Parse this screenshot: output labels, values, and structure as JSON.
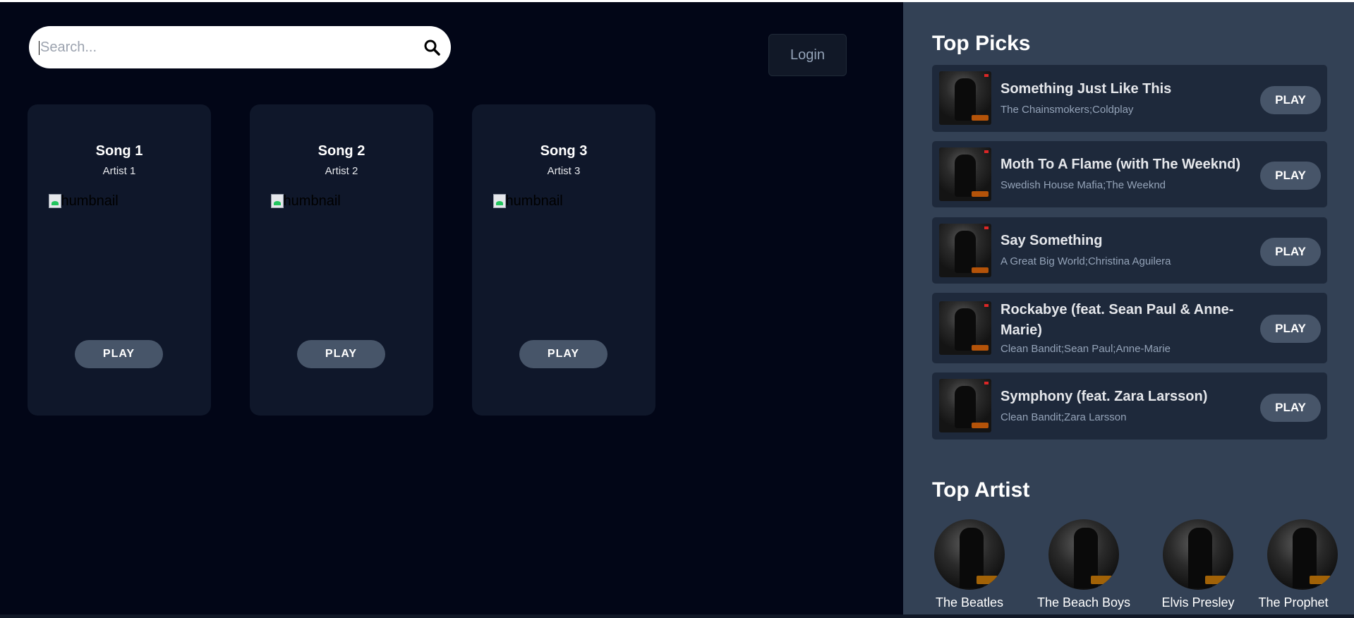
{
  "search": {
    "placeholder": "Search...",
    "icon": "search-icon"
  },
  "header": {
    "login_label": "Login"
  },
  "songs": [
    {
      "title": "Song 1",
      "artist": "Artist 1",
      "thumbnail_alt": "thumbnail",
      "play_label": "PLAY"
    },
    {
      "title": "Song 2",
      "artist": "Artist 2",
      "thumbnail_alt": "thumbnail",
      "play_label": "PLAY"
    },
    {
      "title": "Song 3",
      "artist": "Artist 3",
      "thumbnail_alt": "thumbnail",
      "play_label": "PLAY"
    }
  ],
  "sidebar": {
    "top_picks_title": "Top Picks",
    "picks": [
      {
        "name": "Something Just Like This",
        "artists": "The Chainsmokers;Coldplay",
        "play_label": "PLAY"
      },
      {
        "name": "Moth To A Flame (with The Weeknd)",
        "artists": "Swedish House Mafia;The Weeknd",
        "play_label": "PLAY"
      },
      {
        "name": "Say Something",
        "artists": "A Great Big World;Christina Aguilera",
        "play_label": "PLAY"
      },
      {
        "name": "Rockabye (feat. Sean Paul & Anne-Marie)",
        "artists": "Clean Bandit;Sean Paul;Anne-Marie",
        "play_label": "PLAY"
      },
      {
        "name": "Symphony (feat. Zara Larsson)",
        "artists": "Clean Bandit;Zara Larsson",
        "play_label": "PLAY"
      }
    ],
    "top_artist_title": "Top Artist",
    "artists": [
      {
        "name": "The Beatles"
      },
      {
        "name": "The Beach Boys"
      },
      {
        "name": "Elvis Presley"
      },
      {
        "name": "The Prophet"
      }
    ]
  },
  "colors": {
    "background": "#020617",
    "card": "#0f172a",
    "sidebar": "#334155",
    "pick_row": "#1e293b",
    "button": "#475569"
  }
}
